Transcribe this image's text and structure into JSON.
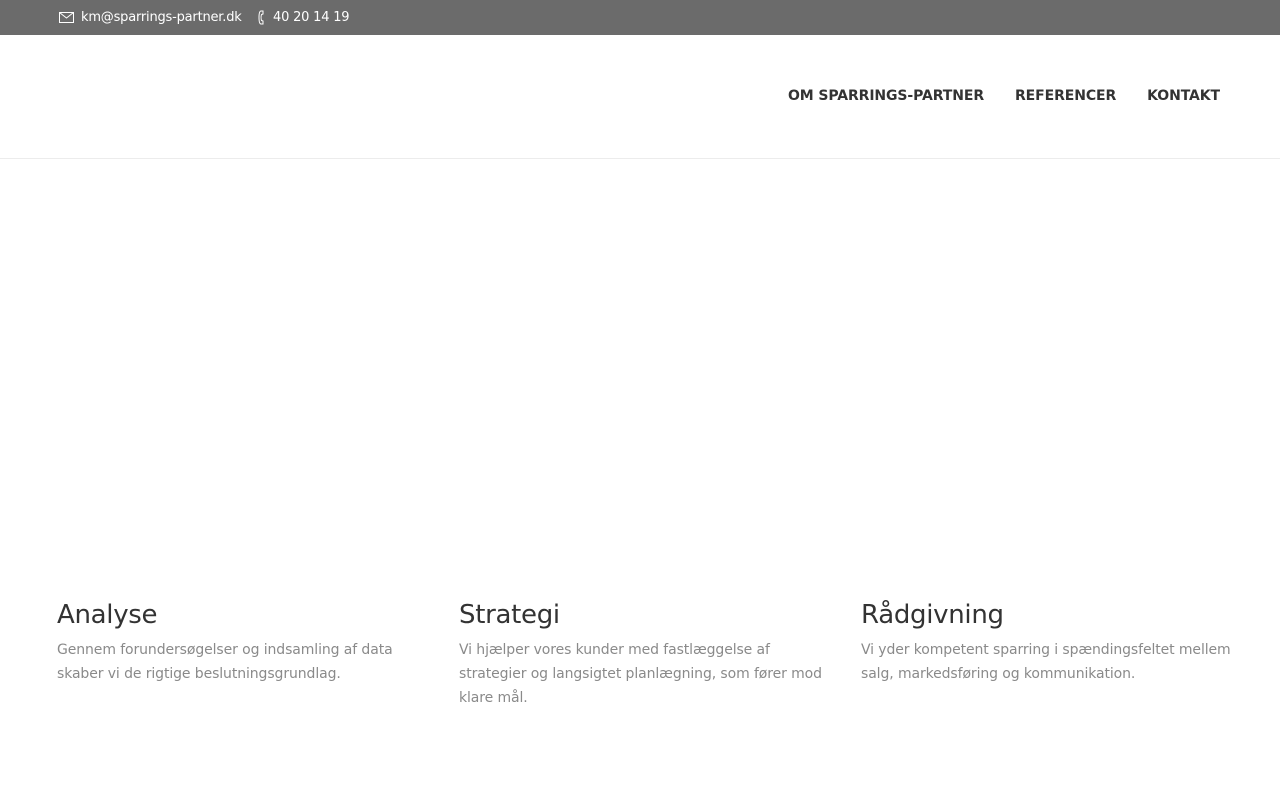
{
  "topbar": {
    "email": "km@sparrings-partner.dk",
    "phone": "40 20 14 19",
    "email_icon": "envelope-icon",
    "phone_icon": "phone-icon"
  },
  "nav": {
    "items": [
      {
        "label": "OM SPARRINGS-PARTNER"
      },
      {
        "label": "REFERENCER"
      },
      {
        "label": "KONTAKT"
      }
    ]
  },
  "features": [
    {
      "title": "Analyse",
      "text": "Gennem forundersøgelser og indsamling af data skaber vi de rigtige beslutningsgrundlag."
    },
    {
      "title": "Strategi",
      "text": "Vi hjælper vores kunder med fastlæggelse af strategier og langsigtet planlægning, som fører mod klare mål."
    },
    {
      "title": "Rådgivning",
      "text": "Vi yder kompetent sparring i spændingsfeltet mellem salg, markedsføring og kommunikation."
    }
  ],
  "colors": {
    "topbar_bg": "#6b6b6b",
    "nav_text": "#333333",
    "heading_text": "#333333",
    "body_text": "#8a8a8a"
  }
}
